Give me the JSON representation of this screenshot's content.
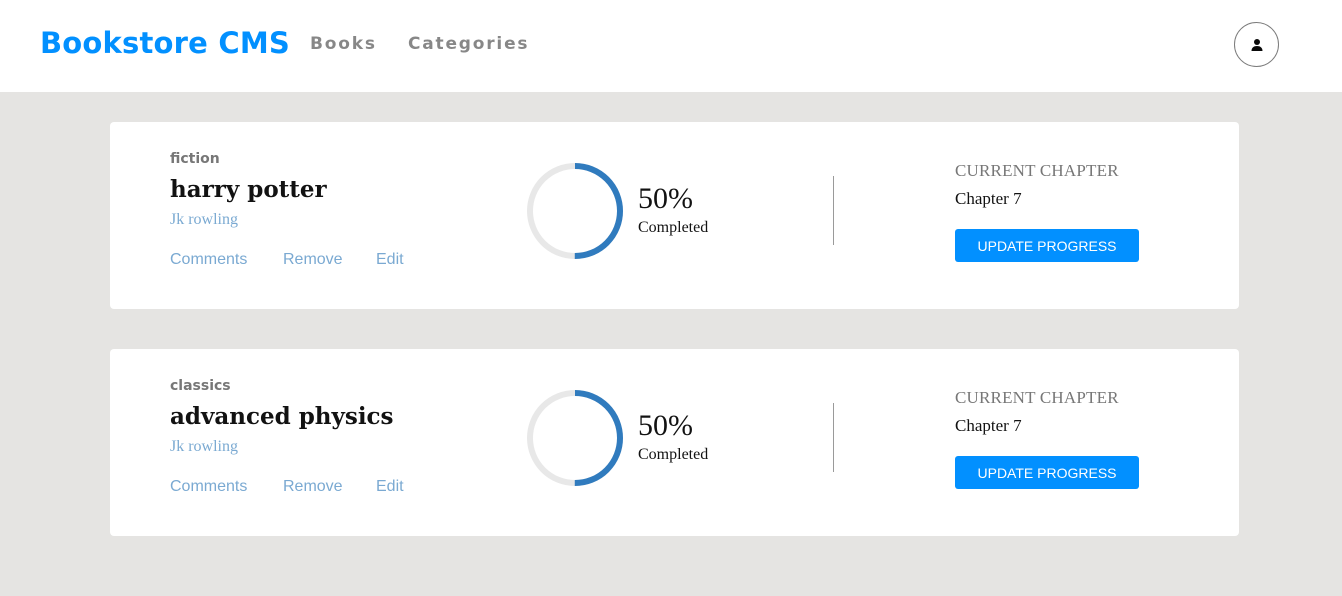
{
  "header": {
    "brand": "Bookstore CMS",
    "nav": {
      "books": "Books",
      "categories": "Categories"
    },
    "icons": {
      "avatar": "user-icon"
    }
  },
  "colors": {
    "brand": "#0290ff",
    "progress": "#307bbe",
    "track": "#e8e8e8",
    "link": "#4386bf",
    "background": "#e5e4e2"
  },
  "books": [
    {
      "category": "fiction",
      "title": "harry potter",
      "author": "Jk rowling",
      "actions": {
        "comments": "Comments",
        "remove": "Remove",
        "edit": "Edit"
      },
      "progress_fraction": 0.5,
      "percent_text": "50%",
      "completed_text": "Completed",
      "chapter_label": "CURRENT CHAPTER",
      "chapter": "Chapter 7",
      "update_label": "UPDATE PROGRESS"
    },
    {
      "category": "classics",
      "title": "advanced physics",
      "author": "Jk rowling",
      "actions": {
        "comments": "Comments",
        "remove": "Remove",
        "edit": "Edit"
      },
      "progress_fraction": 0.5,
      "percent_text": "50%",
      "completed_text": "Completed",
      "chapter_label": "CURRENT CHAPTER",
      "chapter": "Chapter 7",
      "update_label": "UPDATE PROGRESS"
    }
  ]
}
